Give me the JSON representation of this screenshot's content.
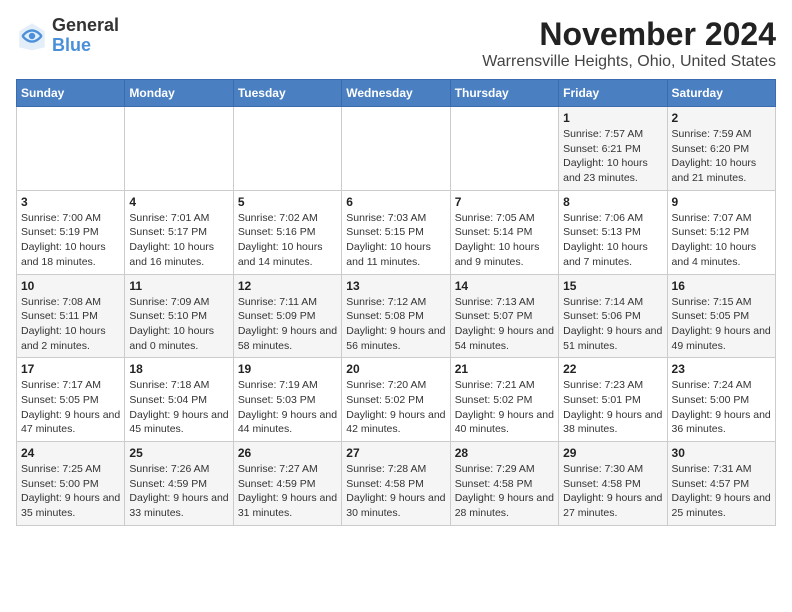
{
  "logo": {
    "general": "General",
    "blue": "Blue"
  },
  "header": {
    "month": "November 2024",
    "location": "Warrensville Heights, Ohio, United States"
  },
  "weekdays": [
    "Sunday",
    "Monday",
    "Tuesday",
    "Wednesday",
    "Thursday",
    "Friday",
    "Saturday"
  ],
  "weeks": [
    [
      {
        "day": "",
        "info": ""
      },
      {
        "day": "",
        "info": ""
      },
      {
        "day": "",
        "info": ""
      },
      {
        "day": "",
        "info": ""
      },
      {
        "day": "",
        "info": ""
      },
      {
        "day": "1",
        "info": "Sunrise: 7:57 AM\nSunset: 6:21 PM\nDaylight: 10 hours and 23 minutes."
      },
      {
        "day": "2",
        "info": "Sunrise: 7:59 AM\nSunset: 6:20 PM\nDaylight: 10 hours and 21 minutes."
      }
    ],
    [
      {
        "day": "3",
        "info": "Sunrise: 7:00 AM\nSunset: 5:19 PM\nDaylight: 10 hours and 18 minutes."
      },
      {
        "day": "4",
        "info": "Sunrise: 7:01 AM\nSunset: 5:17 PM\nDaylight: 10 hours and 16 minutes."
      },
      {
        "day": "5",
        "info": "Sunrise: 7:02 AM\nSunset: 5:16 PM\nDaylight: 10 hours and 14 minutes."
      },
      {
        "day": "6",
        "info": "Sunrise: 7:03 AM\nSunset: 5:15 PM\nDaylight: 10 hours and 11 minutes."
      },
      {
        "day": "7",
        "info": "Sunrise: 7:05 AM\nSunset: 5:14 PM\nDaylight: 10 hours and 9 minutes."
      },
      {
        "day": "8",
        "info": "Sunrise: 7:06 AM\nSunset: 5:13 PM\nDaylight: 10 hours and 7 minutes."
      },
      {
        "day": "9",
        "info": "Sunrise: 7:07 AM\nSunset: 5:12 PM\nDaylight: 10 hours and 4 minutes."
      }
    ],
    [
      {
        "day": "10",
        "info": "Sunrise: 7:08 AM\nSunset: 5:11 PM\nDaylight: 10 hours and 2 minutes."
      },
      {
        "day": "11",
        "info": "Sunrise: 7:09 AM\nSunset: 5:10 PM\nDaylight: 10 hours and 0 minutes."
      },
      {
        "day": "12",
        "info": "Sunrise: 7:11 AM\nSunset: 5:09 PM\nDaylight: 9 hours and 58 minutes."
      },
      {
        "day": "13",
        "info": "Sunrise: 7:12 AM\nSunset: 5:08 PM\nDaylight: 9 hours and 56 minutes."
      },
      {
        "day": "14",
        "info": "Sunrise: 7:13 AM\nSunset: 5:07 PM\nDaylight: 9 hours and 54 minutes."
      },
      {
        "day": "15",
        "info": "Sunrise: 7:14 AM\nSunset: 5:06 PM\nDaylight: 9 hours and 51 minutes."
      },
      {
        "day": "16",
        "info": "Sunrise: 7:15 AM\nSunset: 5:05 PM\nDaylight: 9 hours and 49 minutes."
      }
    ],
    [
      {
        "day": "17",
        "info": "Sunrise: 7:17 AM\nSunset: 5:05 PM\nDaylight: 9 hours and 47 minutes."
      },
      {
        "day": "18",
        "info": "Sunrise: 7:18 AM\nSunset: 5:04 PM\nDaylight: 9 hours and 45 minutes."
      },
      {
        "day": "19",
        "info": "Sunrise: 7:19 AM\nSunset: 5:03 PM\nDaylight: 9 hours and 44 minutes."
      },
      {
        "day": "20",
        "info": "Sunrise: 7:20 AM\nSunset: 5:02 PM\nDaylight: 9 hours and 42 minutes."
      },
      {
        "day": "21",
        "info": "Sunrise: 7:21 AM\nSunset: 5:02 PM\nDaylight: 9 hours and 40 minutes."
      },
      {
        "day": "22",
        "info": "Sunrise: 7:23 AM\nSunset: 5:01 PM\nDaylight: 9 hours and 38 minutes."
      },
      {
        "day": "23",
        "info": "Sunrise: 7:24 AM\nSunset: 5:00 PM\nDaylight: 9 hours and 36 minutes."
      }
    ],
    [
      {
        "day": "24",
        "info": "Sunrise: 7:25 AM\nSunset: 5:00 PM\nDaylight: 9 hours and 35 minutes."
      },
      {
        "day": "25",
        "info": "Sunrise: 7:26 AM\nSunset: 4:59 PM\nDaylight: 9 hours and 33 minutes."
      },
      {
        "day": "26",
        "info": "Sunrise: 7:27 AM\nSunset: 4:59 PM\nDaylight: 9 hours and 31 minutes."
      },
      {
        "day": "27",
        "info": "Sunrise: 7:28 AM\nSunset: 4:58 PM\nDaylight: 9 hours and 30 minutes."
      },
      {
        "day": "28",
        "info": "Sunrise: 7:29 AM\nSunset: 4:58 PM\nDaylight: 9 hours and 28 minutes."
      },
      {
        "day": "29",
        "info": "Sunrise: 7:30 AM\nSunset: 4:58 PM\nDaylight: 9 hours and 27 minutes."
      },
      {
        "day": "30",
        "info": "Sunrise: 7:31 AM\nSunset: 4:57 PM\nDaylight: 9 hours and 25 minutes."
      }
    ]
  ]
}
